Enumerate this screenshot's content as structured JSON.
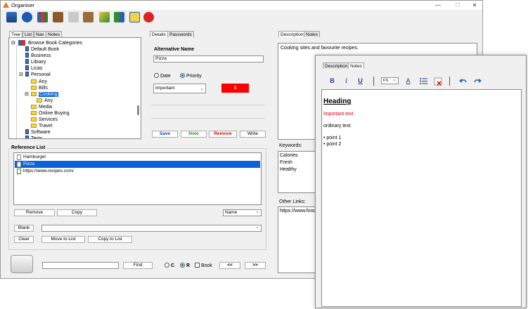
{
  "window": {
    "title": "Organiser",
    "min": "—",
    "max": "☐",
    "close": "✕"
  },
  "toolbar": [
    "book-icon",
    "globe-icon",
    "bookshelf-icon",
    "notebook-icon",
    "copy-icon",
    "paste-icon",
    "picture-icon",
    "image-swap-icon",
    "chat-icon",
    "pie-icon"
  ],
  "left_tabs": [
    "Tree",
    "List",
    "Nav",
    "Notes"
  ],
  "tree": {
    "root": "Browse Book Categories",
    "items": [
      {
        "label": "Default Book",
        "icon": "book"
      },
      {
        "label": "Business",
        "icon": "book"
      },
      {
        "label": "Library",
        "icon": "book"
      },
      {
        "label": "Licas",
        "icon": "book"
      },
      {
        "label": "Personal",
        "icon": "book"
      },
      {
        "label": "Any",
        "icon": "folder"
      },
      {
        "label": "Bills",
        "icon": "folder"
      },
      {
        "label": "Cooking",
        "icon": "folder"
      },
      {
        "label": "Any",
        "icon": "folder"
      },
      {
        "label": "Media",
        "icon": "folder"
      },
      {
        "label": "Online Buying",
        "icon": "folder"
      },
      {
        "label": "Services",
        "icon": "folder"
      },
      {
        "label": "Travel",
        "icon": "folder"
      },
      {
        "label": "Software",
        "icon": "book"
      },
      {
        "label": "Tests",
        "icon": "book"
      }
    ]
  },
  "ref": {
    "title": "Reference List",
    "items": [
      "Hamburger",
      "Pizza",
      "https://www.recipes.com/"
    ],
    "remove": "Remove",
    "copy": "Copy",
    "sort": "Name",
    "blank": "Blank",
    "clear": "Clear",
    "move": "Move to List",
    "copy_to_list": "Copy to List"
  },
  "find": {
    "label": "Find",
    "c": "C",
    "r": "R",
    "book": "Book",
    "prev": "<<",
    "next": ">>"
  },
  "details": {
    "tabs": [
      "Details",
      "Passwords"
    ],
    "alt_name_label": "Alternative Name",
    "alt_name_value": "Pizza",
    "date": "Date",
    "priority": "Priority",
    "priority_value": "Important",
    "color_value": "$",
    "save": "Save",
    "note": "Note",
    "remove": "Remove",
    "write": "Write"
  },
  "desc": {
    "tabs": [
      "Description",
      "Notes"
    ],
    "text": "Cooking sites and favourite recipes.",
    "keywords_label": "Keywords:",
    "keywords": [
      "Calories",
      "Fresh",
      "Healthy"
    ],
    "links_label": "Other Links:",
    "links_value": "https://www.food"
  },
  "notes": {
    "tabs": [
      "Description",
      "Notes"
    ],
    "buttons": {
      "bold": "B",
      "italic": "I",
      "underline": "U",
      "fontsize": "FS",
      "color": "A"
    },
    "heading": "Heading",
    "important": "important text",
    "ordinary": "ordinary text",
    "points": [
      "• point 1",
      "• point 2"
    ]
  },
  "colors": {
    "accent": "#0a64d8",
    "danger": "#ff0000",
    "save": "#1747b8",
    "note": "#2a9d2a",
    "remove": "#d01010"
  }
}
